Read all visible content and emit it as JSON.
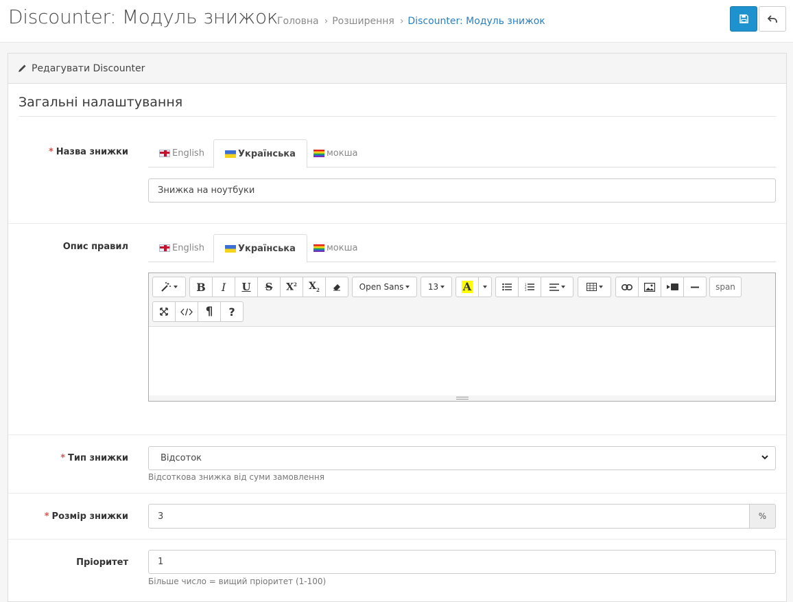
{
  "header": {
    "title": "Discounter: Модуль знижок",
    "breadcrumbs": [
      "Головна",
      "Розширення",
      "Discounter: Модуль знижок"
    ],
    "save_icon": "save-icon",
    "back_icon": "reply-icon",
    "save_color": "#1e91cf"
  },
  "panel": {
    "heading": "Редагувати Discounter",
    "legend": "Загальні налаштування"
  },
  "form": {
    "name": {
      "label": "Назва знижки",
      "required": "*",
      "tabs": [
        "English",
        "Українська",
        "мокша"
      ],
      "active_tab": "Українська",
      "value": "Знижка на ноутбуки"
    },
    "description": {
      "label": "Опис правил",
      "tabs": [
        "English",
        "Українська",
        "мокша"
      ],
      "active_tab": "Українська",
      "toolbar": {
        "font_name": "Open Sans",
        "font_size": "13",
        "style_tag": "span",
        "highlight_glyph": "A",
        "pilcrow": "¶",
        "help": "?"
      },
      "content": ""
    },
    "type": {
      "label": "Тип знижки",
      "required": "*",
      "value": "Відсоток",
      "help": "Відсоткова знижка від суми замовлення"
    },
    "amount": {
      "label": "Розмір знижки",
      "required": "*",
      "value": "3",
      "unit": "%"
    },
    "priority": {
      "label": "Пріоритет",
      "value": "1",
      "help": "Більше число = вищий пріоритет (1-100)"
    }
  }
}
